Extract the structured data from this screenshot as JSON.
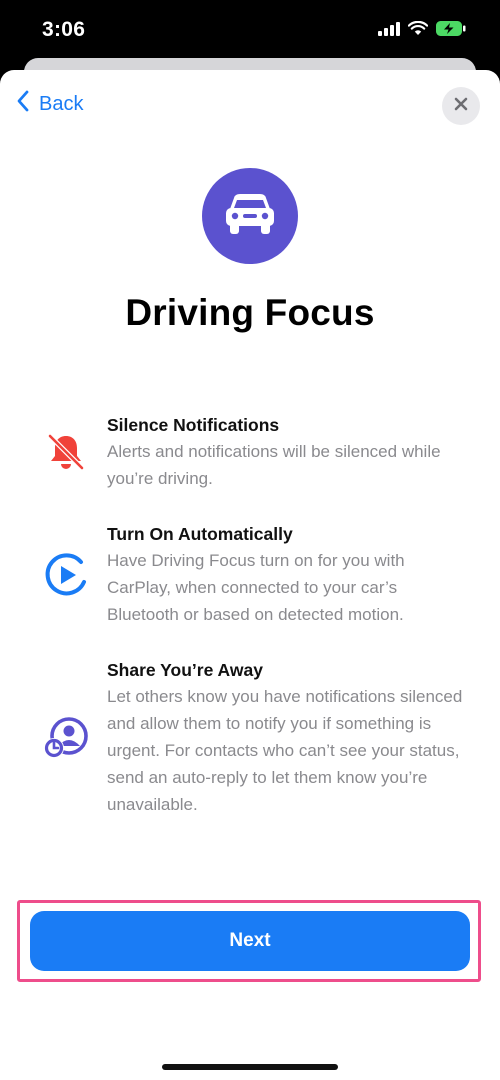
{
  "status_bar": {
    "time": "3:06"
  },
  "nav": {
    "back_label": "Back"
  },
  "page": {
    "title": "Driving Focus"
  },
  "features": [
    {
      "icon": "bell-slash-icon",
      "title": "Silence Notifications",
      "description": "Alerts and notifications will be silenced while you’re driving.",
      "color": "#f0423a"
    },
    {
      "icon": "auto-play-icon",
      "title": "Turn On Automatically",
      "description": "Have Driving Focus turn on for you with CarPlay, when connected to your car’s Bluetooth or based on detected motion.",
      "color": "#1a7cf5"
    },
    {
      "icon": "share-away-icon",
      "title": "Share You’re Away",
      "description": "Let others know you have notifications silenced and allow them to notify you if something is urgent. For contacts who can’t see your status, send an auto-reply to let them know you’re unavailable.",
      "color": "#5b52cf"
    }
  ],
  "footer": {
    "next_label": "Next"
  },
  "colors": {
    "accent": "#1a7cf5",
    "focus_purple": "#5b52cf",
    "highlight": "#ee4d8b"
  }
}
